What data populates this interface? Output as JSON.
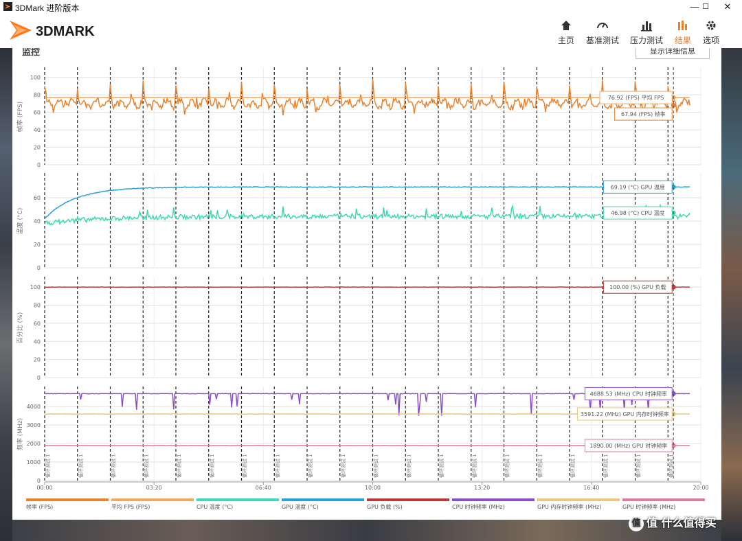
{
  "window": {
    "title": "3DMark 进阶版本",
    "controls": [
      "—",
      "☐",
      "✕"
    ]
  },
  "brand": {
    "logo_text": "3DMARK",
    "accent_color": "#ff7a1a"
  },
  "nav": {
    "items": [
      {
        "label": "主页",
        "icon": "home-icon"
      },
      {
        "label": "基准测试",
        "icon": "gauge-icon"
      },
      {
        "label": "压力测试",
        "icon": "bars-icon"
      },
      {
        "label": "结果",
        "icon": "results-icon",
        "active": true
      },
      {
        "label": "选项",
        "icon": "gear-icon"
      }
    ]
  },
  "panel": {
    "title": "监控",
    "details_button": "显示详细信息"
  },
  "chart_data": {
    "type": "line",
    "x_range": [
      0,
      1200
    ],
    "x_ticks": [
      "00:00",
      "03:20",
      "06:40",
      "10:00",
      "13:20",
      "16:40",
      "20:00"
    ],
    "loop_label": "循环测试 1",
    "loop_marker_times": [
      0,
      60,
      120,
      180,
      240,
      300,
      360,
      420,
      480,
      540,
      600,
      660,
      720,
      780,
      840,
      900,
      960,
      1020,
      1080,
      1140
    ],
    "cursor_time": 1150,
    "panels": [
      {
        "ylabel": "帧率 (FPS)",
        "yticks": [
          0,
          20,
          40,
          60,
          80,
          100
        ],
        "ylim": [
          0,
          110
        ],
        "series": [
          {
            "name": "帧率 (FPS)",
            "color": "#e8822d",
            "pattern": "fps",
            "base": 72,
            "end_value": 67.94,
            "label": "67.94 (FPS) 帧率"
          },
          {
            "name": "平均 FPS (FPS)",
            "color": "#f0a860",
            "pattern": "flat",
            "base": 76.92,
            "end_value": 76.92,
            "label": "76.92 (FPS) 平均 FPS"
          }
        ]
      },
      {
        "ylabel": "温度 (°C)",
        "yticks": [
          0,
          20,
          40,
          60
        ],
        "ylim": [
          0,
          80
        ],
        "series": [
          {
            "name": "GPU 温度 (°C)",
            "color": "#2aa0d8",
            "pattern": "warmup",
            "base": 69.2,
            "start": 42,
            "end_value": 69.19,
            "label": "69.19 (°C) GPU 温度"
          },
          {
            "name": "CPU 温度 (°C)",
            "color": "#3dd9b4",
            "pattern": "noisy",
            "base": 44,
            "start": 38,
            "end_value": 46.98,
            "label": "46.98 (°C) CPU 温度"
          }
        ]
      },
      {
        "ylabel": "百分比 (%)",
        "yticks": [
          0,
          20,
          40,
          60,
          80,
          100
        ],
        "ylim": [
          0,
          110
        ],
        "series": [
          {
            "name": "GPU 负载 (%)",
            "color": "#b83a3a",
            "pattern": "flat",
            "base": 100,
            "end_value": 100.0,
            "label": "100.00 (%) GPU 负载"
          }
        ]
      },
      {
        "ylabel": "频率 (MHz)",
        "yticks": [
          0,
          1000,
          2000,
          3000,
          4000
        ],
        "ylim": [
          0,
          5000
        ],
        "series": [
          {
            "name": "CPU 时钟频率 (MHz)",
            "color": "#8a4fc8",
            "pattern": "dips",
            "base": 4690,
            "end_value": 4688.53,
            "label": "4688.53 (MHz) CPU 时钟频率"
          },
          {
            "name": "GPU 内存时钟频率 (MHz)",
            "color": "#e8c87a",
            "pattern": "flat",
            "base": 3591.22,
            "end_value": 3591.22,
            "label": "3591.22 (MHz) GPU 内存时钟频率"
          },
          {
            "name": "GPU 时钟频率 (MHz)",
            "color": "#e07ba0",
            "pattern": "flat",
            "base": 1890,
            "end_value": 1890.0,
            "label": "1890.00 (MHz) GPU 时钟频率"
          }
        ]
      }
    ],
    "legend": [
      {
        "name": "帧率 (FPS)",
        "color": "#e8822d"
      },
      {
        "name": "平均 FPS (FPS)",
        "color": "#f0a860"
      },
      {
        "name": "CPU 温度 (°C)",
        "color": "#3dd9b4"
      },
      {
        "name": "GPU 温度 (°C)",
        "color": "#2aa0d8"
      },
      {
        "name": "GPU 负载 (%)",
        "color": "#b83a3a"
      },
      {
        "name": "CPU 时钟频率 (MHz)",
        "color": "#8a4fc8"
      },
      {
        "name": "GPU 内存时钟频率 (MHz)",
        "color": "#e8c87a"
      },
      {
        "name": "GPU 时钟频率 (MHz)",
        "color": "#e07ba0"
      }
    ]
  },
  "watermark": "值 什么值得买"
}
